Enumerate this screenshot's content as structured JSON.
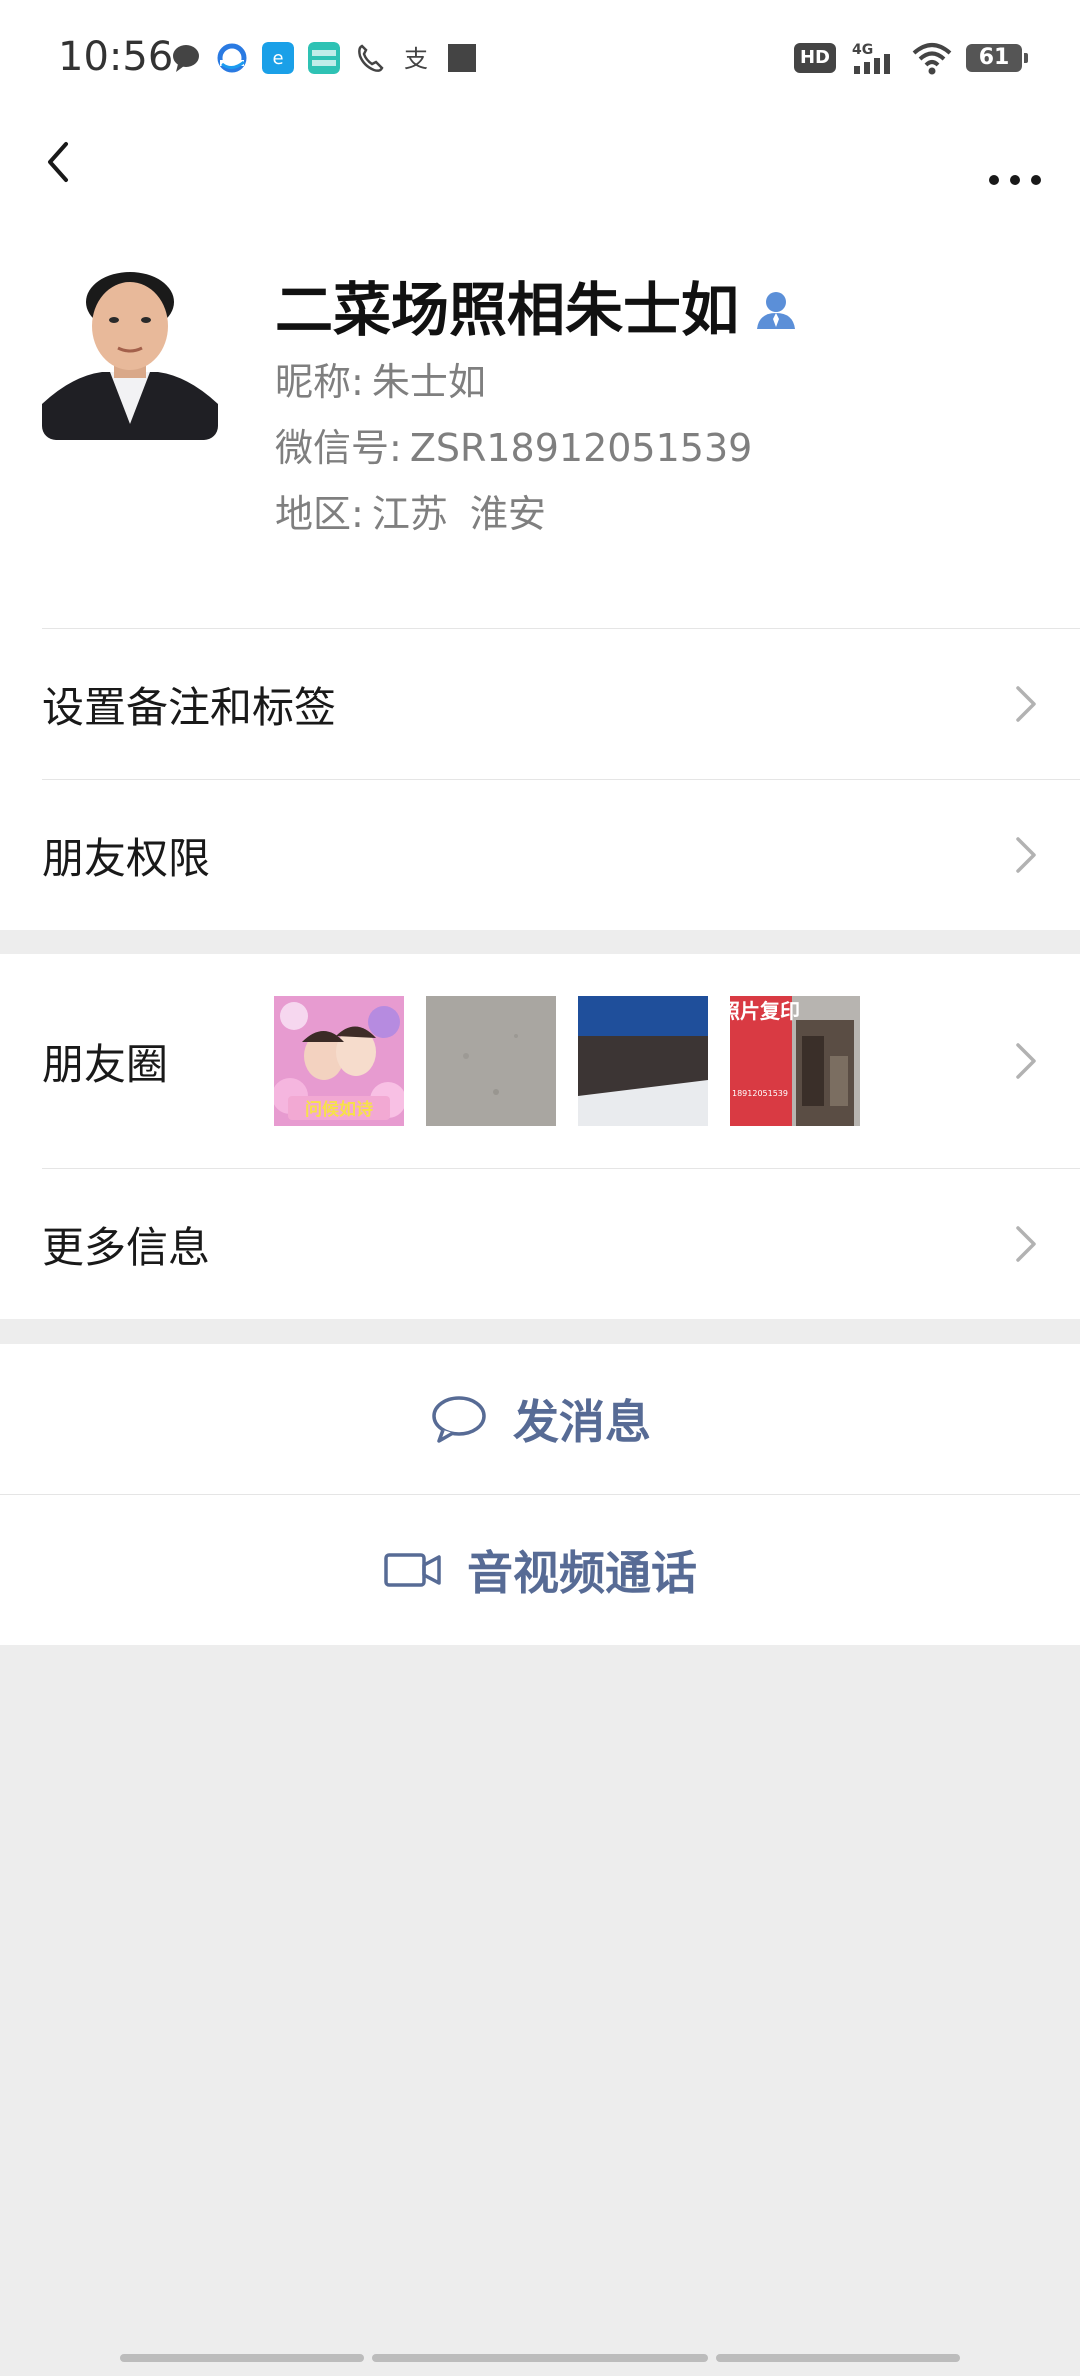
{
  "status_bar": {
    "time": "10:56",
    "hd_badge": "HD",
    "network": "4G",
    "battery": "61",
    "notification_icons": [
      "message-bubble-icon",
      "qq-browser-icon",
      "e-app-icon",
      "boss-zhipin-icon",
      "phone-call-icon",
      "alipay-icon",
      "square-icon"
    ]
  },
  "nav": {
    "back_icon": "chevron-left-icon",
    "more_icon": "more-dots-icon"
  },
  "profile": {
    "name": "二菜场照相朱士如",
    "nickname_label": "昵称:",
    "nickname": "朱士如",
    "wechat_id_label": "微信号:",
    "wechat_id": "ZSR18912051539",
    "region_label": "地区:",
    "region_province": "江苏",
    "region_city": "淮安"
  },
  "menu": {
    "remark_tags": "设置备注和标签",
    "friend_permissions": "朋友权限",
    "moments": "朋友圈",
    "more_info": "更多信息"
  },
  "moments_thumbs": {
    "thumb1_caption": "问候如诗",
    "thumb4_title": "照片复印",
    "thumb4_phone": "18912051539"
  },
  "actions": {
    "send_message": "发消息",
    "video_call": "音视频通话"
  },
  "colors": {
    "accent_link": "#576b95",
    "page_bg": "#ededed",
    "verified_blue": "#5b8fd8"
  }
}
